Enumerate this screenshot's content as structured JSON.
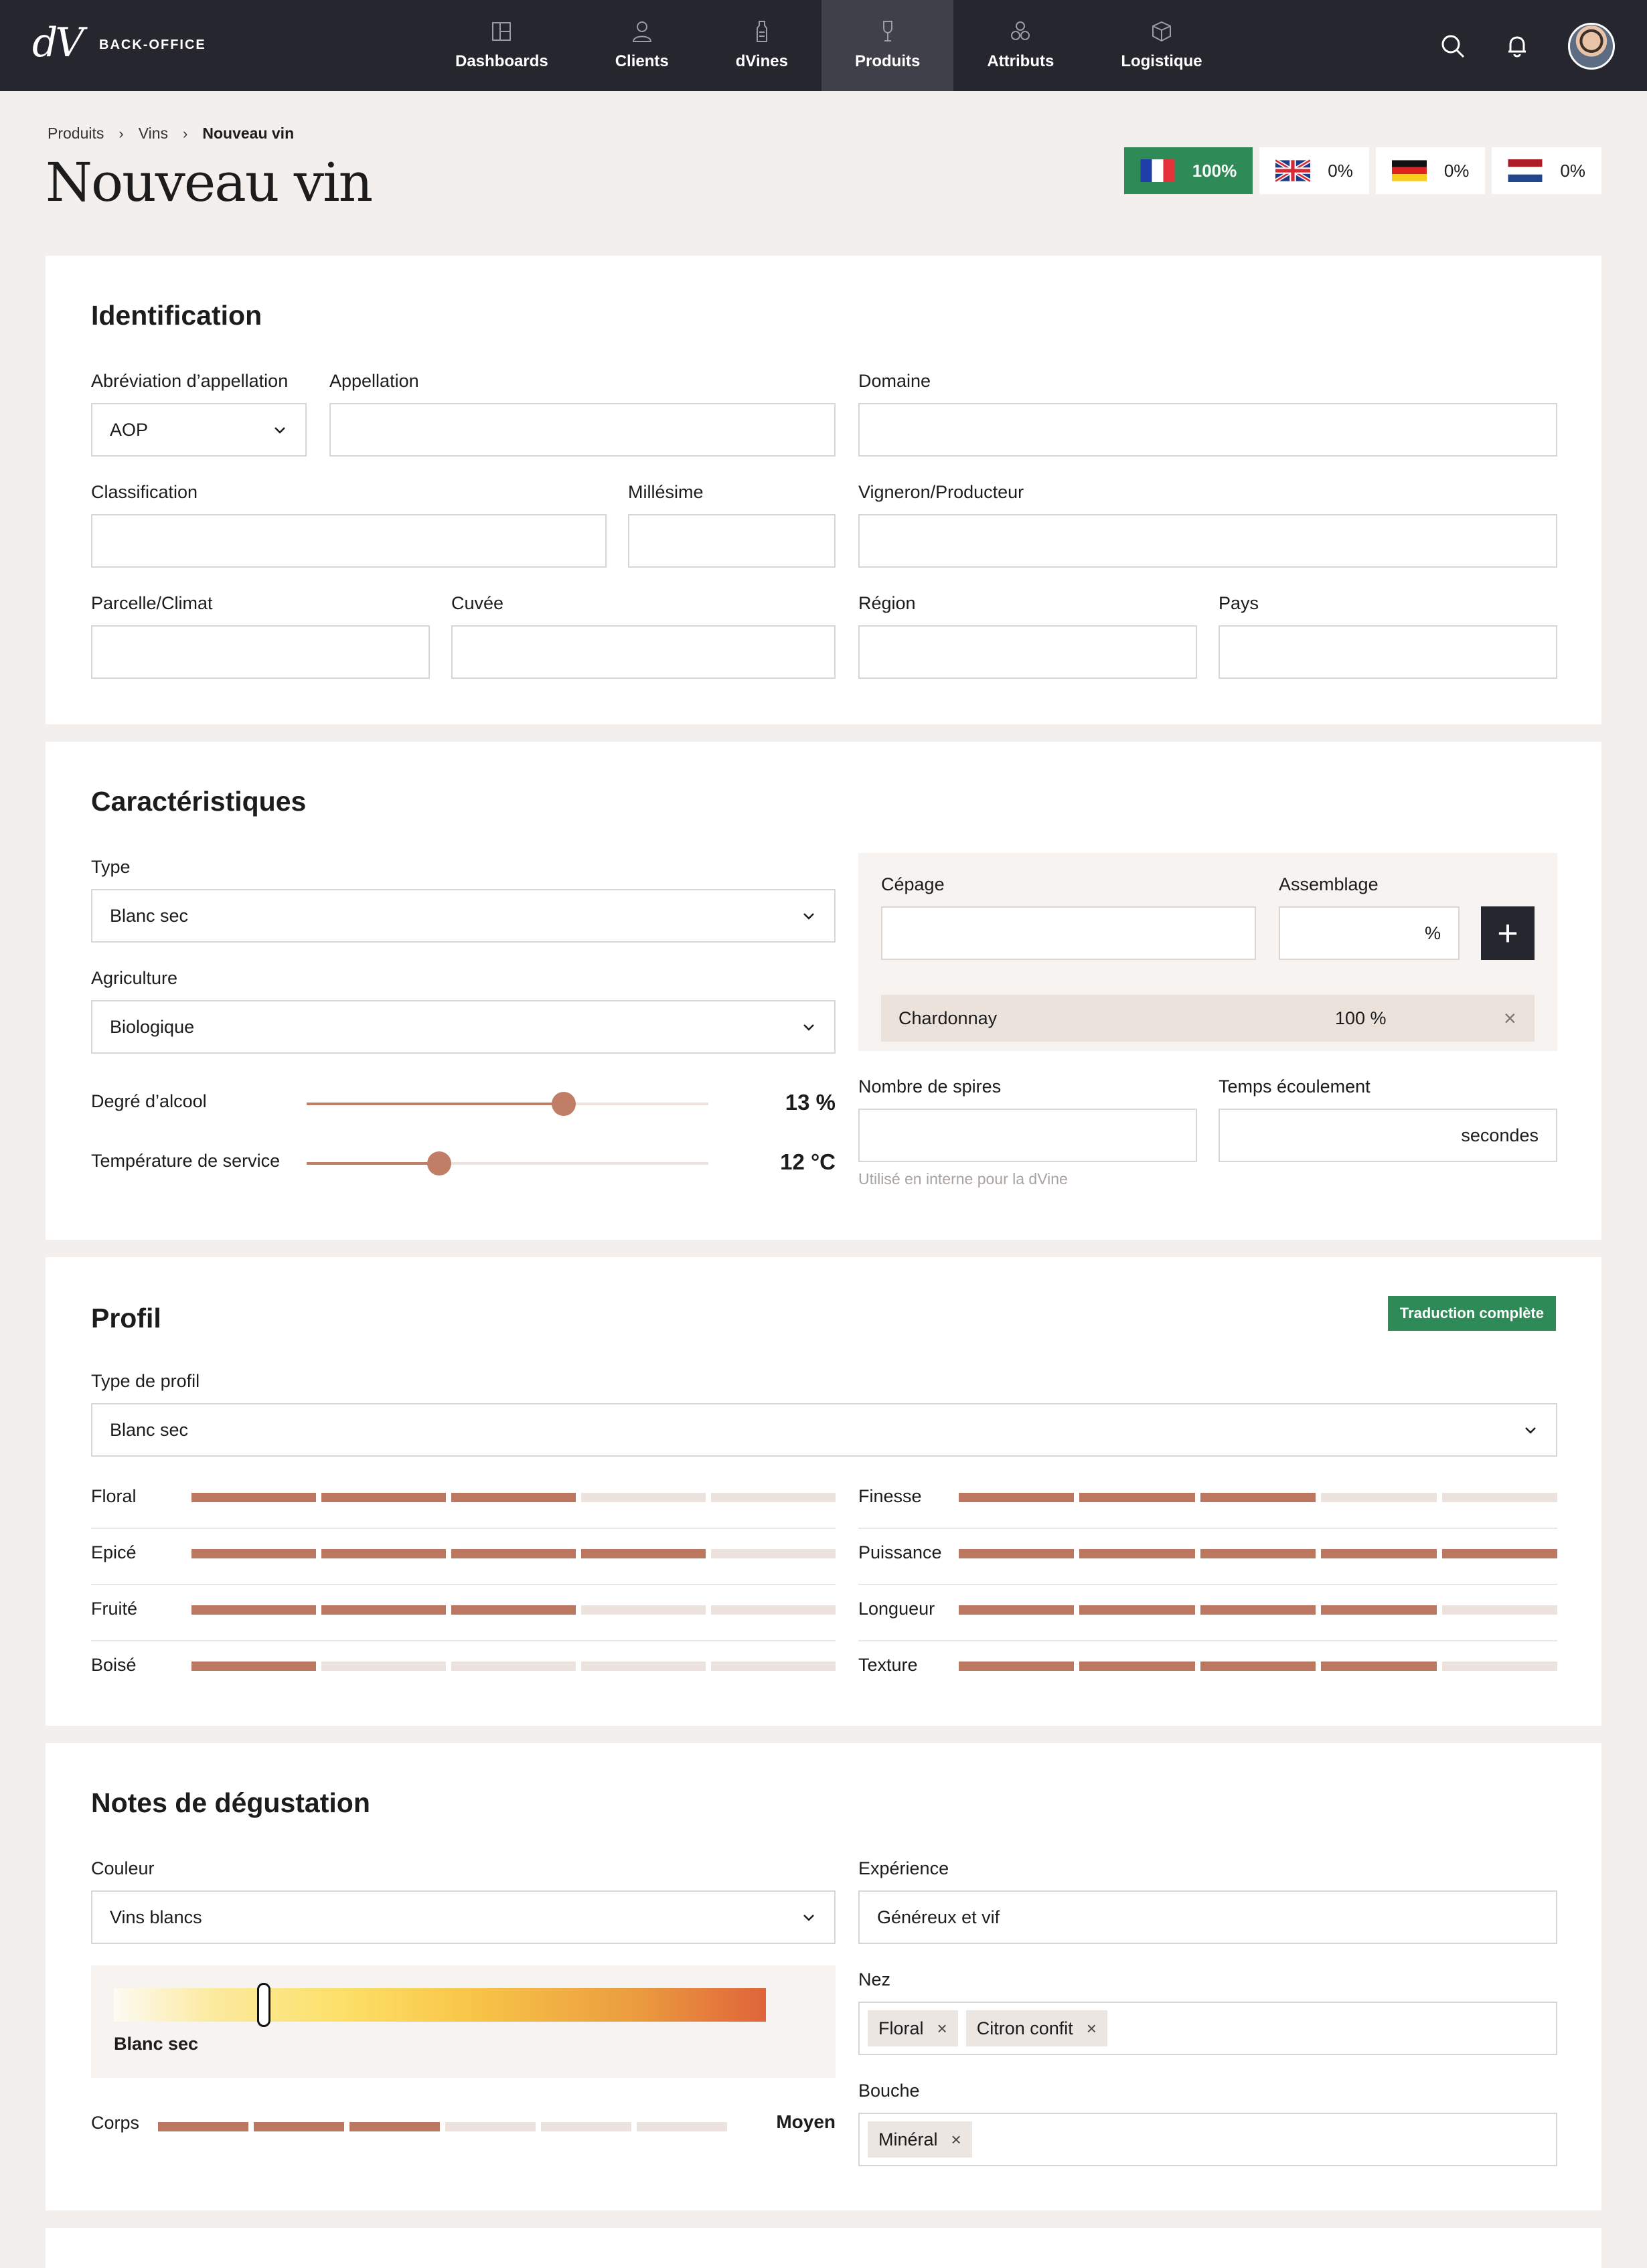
{
  "app": {
    "logo": "dV",
    "logo_text": "BACK-OFFICE"
  },
  "nav": {
    "items": [
      {
        "label": "Dashboards",
        "icon": "dashboard-icon"
      },
      {
        "label": "Clients",
        "icon": "user-icon"
      },
      {
        "label": "dVines",
        "icon": "bottle-icon"
      },
      {
        "label": "Produits",
        "icon": "wine-glass-icon",
        "active": true
      },
      {
        "label": "Attributs",
        "icon": "attributes-icon"
      },
      {
        "label": "Logistique",
        "icon": "box-icon"
      }
    ]
  },
  "breadcrumb": [
    "Produits",
    "Vins",
    "Nouveau vin"
  ],
  "page": {
    "title": "Nouveau vin"
  },
  "languages": [
    {
      "code": "fr",
      "value": "100%",
      "active": true
    },
    {
      "code": "en",
      "value": "0%"
    },
    {
      "code": "de",
      "value": "0%"
    },
    {
      "code": "nl",
      "value": "0%"
    }
  ],
  "identification": {
    "title": "Identification",
    "abbr_label": "Abréviation d’appellation",
    "abbr_value": "AOP",
    "appellation_label": "Appellation",
    "domaine_label": "Domaine",
    "classification_label": "Classification",
    "millesime_label": "Millésime",
    "vigneron_label": "Vigneron/Producteur",
    "parcelle_label": "Parcelle/Climat",
    "cuvee_label": "Cuvée",
    "region_label": "Région",
    "pays_label": "Pays"
  },
  "caracteristiques": {
    "title": "Caractéristiques",
    "type_label": "Type",
    "type_value": "Blanc sec",
    "agriculture_label": "Agriculture",
    "agriculture_value": "Biologique",
    "alcool_label": "Degré d’alcool",
    "alcool_value": "13 %",
    "alcool_fraction": 0.64,
    "temp_label": "Température de service",
    "temp_value": "12 °C",
    "temp_fraction": 0.33,
    "cepage_label": "Cépage",
    "assemblage_label": "Assemblage",
    "percent_suffix": "%",
    "add_symbol": "+",
    "cepages": [
      {
        "name": "Chardonnay",
        "value": "100 %"
      }
    ],
    "remove_symbol": "×",
    "spires_label": "Nombre de spires",
    "spires_hint": "Utilisé en interne pour la dVine",
    "ecoulement_label": "Temps écoulement",
    "ecoulement_suffix": "secondes"
  },
  "profil": {
    "title": "Profil",
    "badge": "Traduction complète",
    "type_label": "Type de profil",
    "type_value": "Blanc sec",
    "left": [
      {
        "label": "Floral",
        "level": 3
      },
      {
        "label": "Epicé",
        "level": 4
      },
      {
        "label": "Fruité",
        "level": 3
      },
      {
        "label": "Boisé",
        "level": 1
      }
    ],
    "right": [
      {
        "label": "Finesse",
        "level": 3
      },
      {
        "label": "Puissance",
        "level": 5
      },
      {
        "label": "Longueur",
        "level": 4
      },
      {
        "label": "Texture",
        "level": 4
      }
    ],
    "max_level": 5
  },
  "degustation": {
    "title": "Notes de dégustation",
    "couleur_label": "Couleur",
    "couleur_value": "Vins blancs",
    "color_caption": "Blanc sec",
    "color_fraction": 0.23,
    "corps_label": "Corps",
    "corps_level": 3,
    "corps_max": 6,
    "corps_value": "Moyen",
    "experience_label": "Expérience",
    "experience_value": "Généreux et vif",
    "nez_label": "Nez",
    "nez_tags": [
      "Floral",
      "Citron confit"
    ],
    "bouche_label": "Bouche",
    "bouche_tags": [
      "Minéral"
    ],
    "tag_remove": "×"
  },
  "colors": {
    "nav_bg": "#26262f",
    "accent": "#bb7760",
    "success": "#2e8a56",
    "page_bg": "#f3efec"
  }
}
